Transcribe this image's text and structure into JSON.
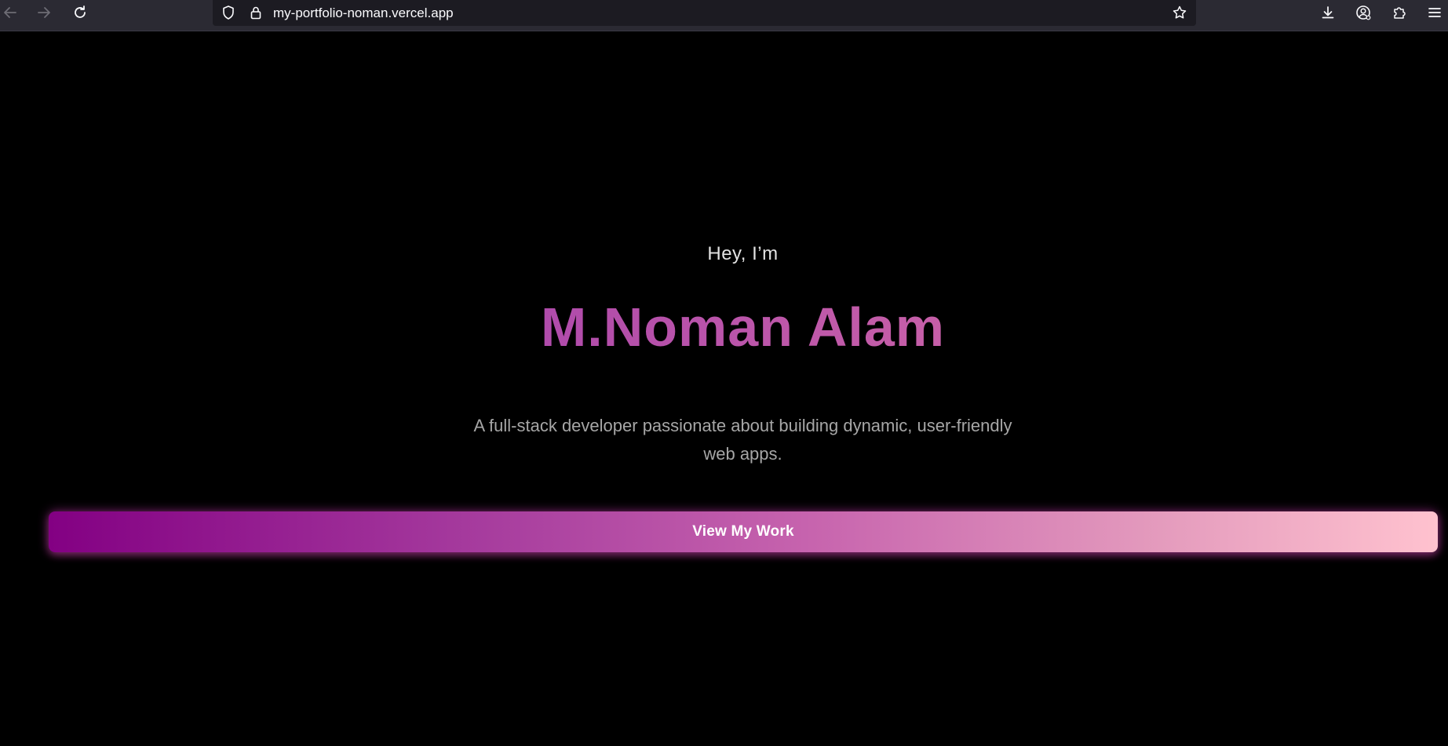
{
  "browser": {
    "url": "my-portfolio-noman.vercel.app",
    "icons": {
      "back": "back-arrow-icon",
      "forward": "forward-arrow-icon",
      "reload": "reload-icon",
      "shield": "tracking-protection-shield-icon",
      "lock": "lock-icon",
      "bookmark": "star-bookmark-icon",
      "downloads": "download-icon",
      "account": "account-icon",
      "extensions": "puzzle-extensions-icon",
      "menu": "hamburger-menu-icon"
    }
  },
  "hero": {
    "greeting": "Hey, I’m",
    "name": "M.Noman Alam",
    "tagline": "A full-stack developer passionate about building dynamic, user-friendly web apps.",
    "cta_label": "View My Work"
  },
  "colors": {
    "background": "#000000",
    "name_gradient_start": "#b04bab",
    "name_gradient_end": "#c65fa8",
    "button_gradient_start": "#830083",
    "button_gradient_end": "#ffc2cf"
  }
}
